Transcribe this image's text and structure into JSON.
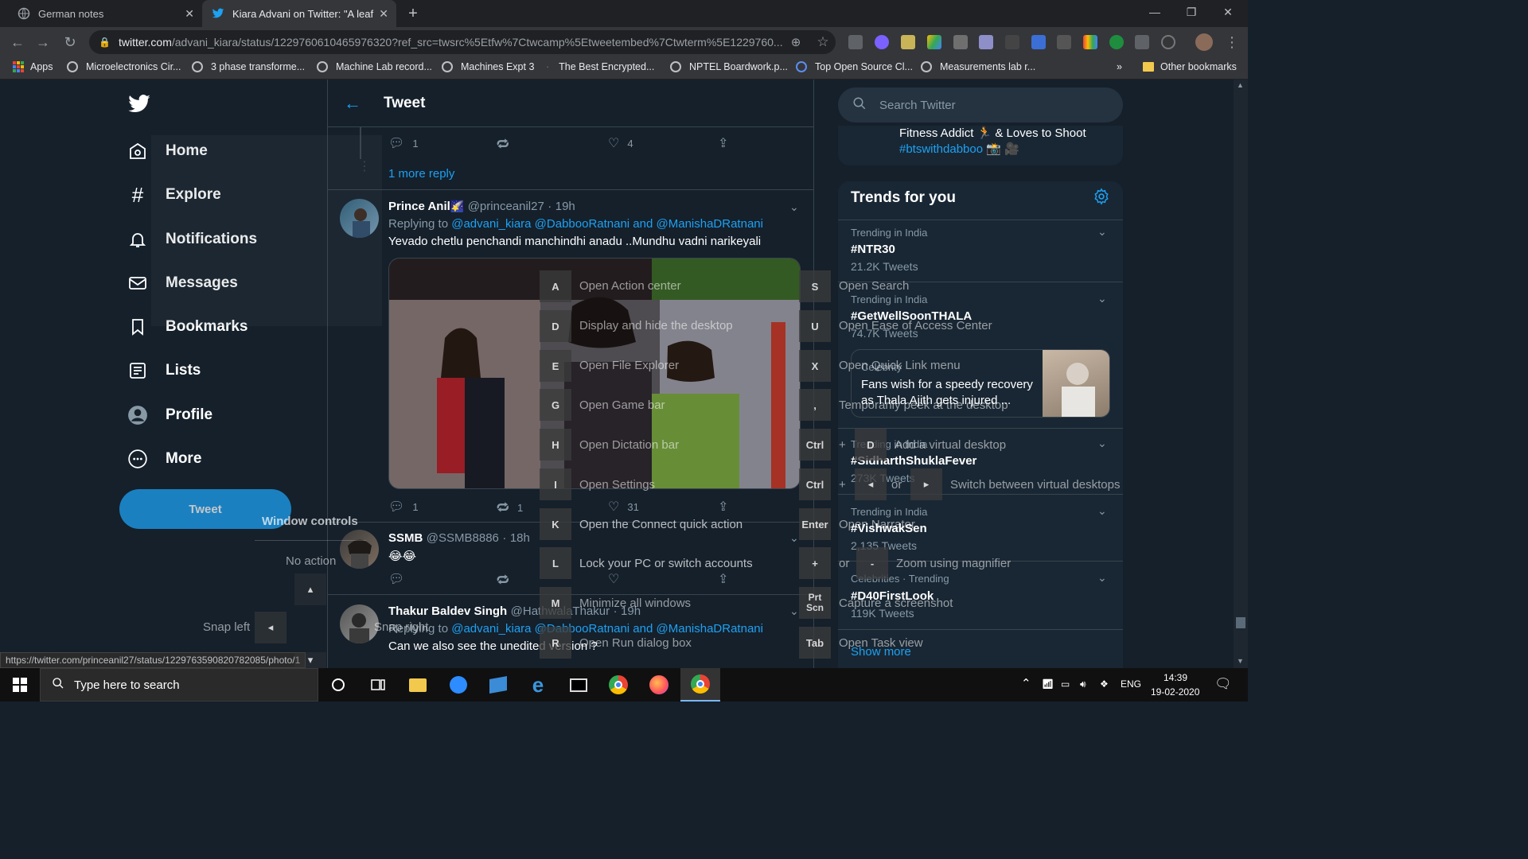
{
  "browser": {
    "tabs": [
      {
        "title": "German notes"
      },
      {
        "title": "Kiara Advani on Twitter: \"A leaf o"
      }
    ],
    "url_host": "twitter.com",
    "url_path": "/advani_kiara/status/1229760610465976320?ref_src=twsrc%5Etfw%7Ctwcamp%5Etweetembed%7Ctwterm%5E1229760...",
    "bookmarks": [
      {
        "label": "Apps"
      },
      {
        "label": "Microelectronics Cir..."
      },
      {
        "label": "3 phase transforme..."
      },
      {
        "label": "Machine Lab record..."
      },
      {
        "label": "Machines Expt 3"
      },
      {
        "label": "The Best Encrypted..."
      },
      {
        "label": "NPTEL Boardwork.p..."
      },
      {
        "label": "Top Open Source Cl..."
      },
      {
        "label": "Measurements lab r..."
      },
      {
        "label": "Other bookmarks"
      }
    ],
    "overflow": "»",
    "status_url": "https://twitter.com/princeanil27/status/1229763590820782085/photo/1"
  },
  "sidenav": {
    "items": [
      {
        "label": "Home"
      },
      {
        "label": "Explore"
      },
      {
        "label": "Notifications"
      },
      {
        "label": "Messages"
      },
      {
        "label": "Bookmarks"
      },
      {
        "label": "Lists"
      },
      {
        "label": "Profile"
      },
      {
        "label": "More"
      }
    ],
    "tweet_button": "Tweet"
  },
  "timeline": {
    "title": "Tweet",
    "top_actions": {
      "replies": "1",
      "likes": "4"
    },
    "more_replies": "1 more reply",
    "tweets": [
      {
        "name": "Prince Anil",
        "badge": "🌠",
        "handle": "@princeanil27",
        "time": "19h",
        "replying_to": "Replying to",
        "mentions": "@advani_kiara @DabbooRatnani and @ManishaDRatnani",
        "text": "Yevado chetlu penchandi manchindhi anadu ..Mundhu vadni narikeyali",
        "replies": "1",
        "retweets": "1",
        "likes": "31"
      },
      {
        "name": "SSMB",
        "handle": "@SSMB8886",
        "time": "18h",
        "text": "😂😂"
      },
      {
        "name": "Thakur Baldev Singh",
        "handle": "@HathwalaThakur",
        "time": "19h",
        "replying_to": "Replying to",
        "mentions": "@advani_kiara @DabbooRatnani and @ManishaDRatnani",
        "text": "Can we also see the unedited version ?"
      }
    ]
  },
  "right": {
    "search_placeholder": "Search Twitter",
    "prev_card_line1": "Fitness Addict 🏃 & Loves to Shoot",
    "prev_card_line2": "#btswithdabboo 📸 🎥",
    "trends_title": "Trends for you",
    "trends": [
      {
        "meta": "Trending in India",
        "name": "#NTR30",
        "count": "21.2K Tweets"
      },
      {
        "meta": "Trending in India",
        "name": "#GetWellSoonTHALA",
        "count": "74.7K Tweets"
      },
      {
        "meta": "Celebrity",
        "name": "Fans wish for a speedy recovery as Thala Ajith gets injured ..."
      },
      {
        "meta": "Trending in India",
        "name": "#SidharthShuklaFever",
        "count": "273K Tweets"
      },
      {
        "meta": "Trending in India",
        "name": "#VishwakSen",
        "count": "2,135 Tweets"
      },
      {
        "meta": "Celebrities · Trending",
        "name": "#D40FirstLook",
        "count": "119K Tweets"
      }
    ],
    "show_more": "Show more"
  },
  "shortcuts_overlay": {
    "left_items": [
      {
        "key": "A",
        "label": "Open Action center"
      },
      {
        "key": "D",
        "label": "Display and hide the desktop"
      },
      {
        "key": "E",
        "label": "Open File Explorer"
      },
      {
        "key": "G",
        "label": "Open Game bar"
      },
      {
        "key": "H",
        "label": "Open Dictation bar"
      },
      {
        "key": "I",
        "label": "Open Settings"
      },
      {
        "key": "K",
        "label": "Open the Connect quick action"
      },
      {
        "key": "L",
        "label": "Lock your PC or switch accounts"
      },
      {
        "key": "M",
        "label": "Minimize all windows"
      },
      {
        "key": "R",
        "label": "Open Run dialog box"
      }
    ],
    "right_items": [
      {
        "key": "S",
        "label": "Open Search"
      },
      {
        "key": "U",
        "label": "Open Ease of Access Center"
      },
      {
        "key": "X",
        "label": "Open Quick Link menu"
      },
      {
        "key": ",",
        "label": "Temporarily peek at the desktop"
      },
      {
        "key": "Ctrl",
        "label": "Add a virtual desktop",
        "extra_key": "D"
      },
      {
        "key": "Ctrl",
        "label": "Switch between virtual desktops",
        "or": "or"
      },
      {
        "key": "Enter",
        "label": "Open Narrator"
      },
      {
        "key": "+",
        "label": "Zoom using magnifier",
        "or": "or",
        "extra_key": "-"
      },
      {
        "key": "Prt Scn",
        "label": "Capture a screenshot"
      },
      {
        "key": "Tab",
        "label": "Open Task view"
      }
    ],
    "window_controls_title": "Window controls",
    "no_action": "No action",
    "snap_left": "Snap left",
    "snap_right": "Snap right"
  },
  "taskbar": {
    "search_placeholder": "Type here to search",
    "lang": "ENG",
    "time": "14:39",
    "date": "19-02-2020"
  }
}
